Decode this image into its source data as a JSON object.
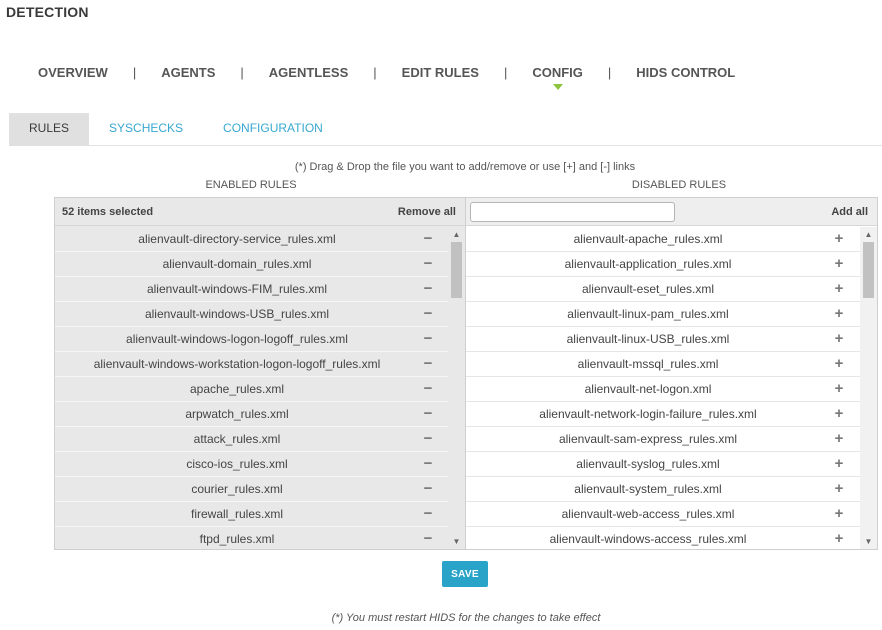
{
  "page": {
    "title": "DETECTION"
  },
  "mainnav": {
    "items": [
      {
        "label": "OVERVIEW",
        "active": false
      },
      {
        "label": "AGENTS",
        "active": false
      },
      {
        "label": "AGENTLESS",
        "active": false
      },
      {
        "label": "EDIT RULES",
        "active": false
      },
      {
        "label": "CONFIG",
        "active": true
      },
      {
        "label": "HIDS CONTROL",
        "active": false
      }
    ],
    "separator": "|",
    "active_indicator_color": "#8cc43f"
  },
  "subtabs": [
    {
      "label": "RULES",
      "active": true
    },
    {
      "label": "SYSCHECKS",
      "active": false
    },
    {
      "label": "CONFIGURATION",
      "active": false
    }
  ],
  "hint": "(*) Drag & Drop the file you want to add/remove or use [+] and [-] links",
  "enabled": {
    "caption": "ENABLED RULES",
    "count_label": "52 items selected",
    "remove_all_label": "Remove all",
    "action_icon": "minus-icon",
    "action_symbol": "−",
    "scroll_fraction": 0.0,
    "items": [
      "alienvault-directory-service_rules.xml",
      "alienvault-domain_rules.xml",
      "alienvault-windows-FIM_rules.xml",
      "alienvault-windows-USB_rules.xml",
      "alienvault-windows-logon-logoff_rules.xml",
      "alienvault-windows-workstation-logon-logoff_rules.xml",
      "apache_rules.xml",
      "arpwatch_rules.xml",
      "attack_rules.xml",
      "cisco-ios_rules.xml",
      "courier_rules.xml",
      "firewall_rules.xml",
      "ftpd_rules.xml"
    ]
  },
  "disabled": {
    "caption": "DISABLED RULES",
    "search_value": "",
    "search_placeholder": "",
    "add_all_label": "Add all",
    "action_icon": "plus-icon",
    "action_symbol": "+",
    "scroll_fraction": 0.0,
    "items": [
      "alienvault-apache_rules.xml",
      "alienvault-application_rules.xml",
      "alienvault-eset_rules.xml",
      "alienvault-linux-pam_rules.xml",
      "alienvault-linux-USB_rules.xml",
      "alienvault-mssql_rules.xml",
      "alienvault-net-logon.xml",
      "alienvault-network-login-failure_rules.xml",
      "alienvault-sam-express_rules.xml",
      "alienvault-syslog_rules.xml",
      "alienvault-system_rules.xml",
      "alienvault-web-access_rules.xml",
      "alienvault-windows-access_rules.xml"
    ]
  },
  "save_label": "SAVE",
  "footnote": "(*) You must restart HIDS for the changes to take effect",
  "colors": {
    "accent": "#29a3c8",
    "link": "#38a8d0",
    "active_tab_bg": "#e0e0e0"
  }
}
